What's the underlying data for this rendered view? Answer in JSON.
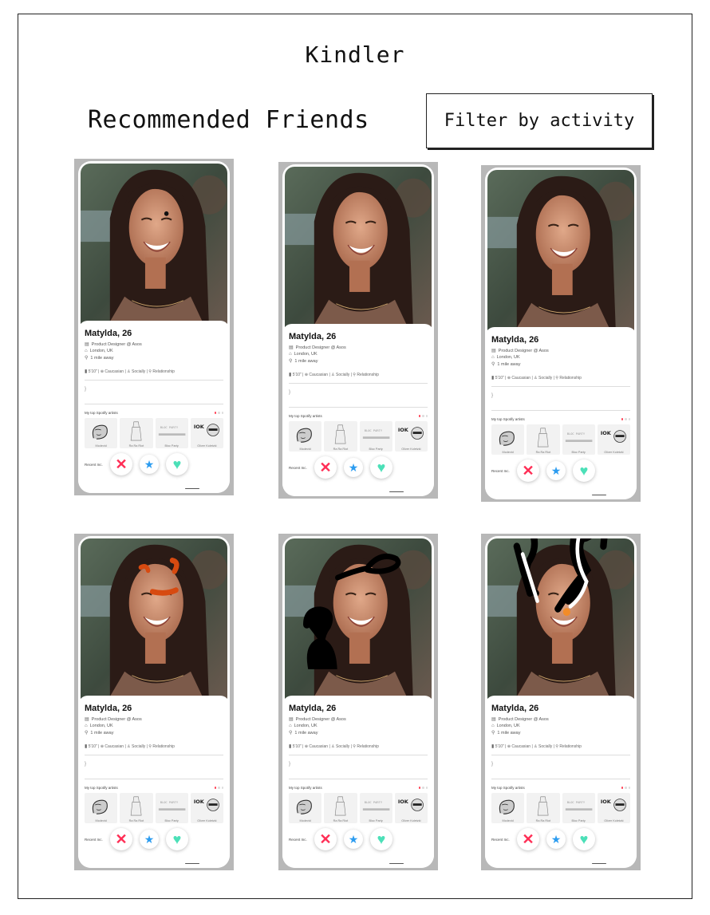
{
  "app": {
    "title": "Kindler"
  },
  "header": {
    "section_title": "Recommended Friends",
    "filter_label": "Filter by activity"
  },
  "colors": {
    "nope": "#ff2d55",
    "star": "#2c9cf0",
    "heart": "#4ce0b8",
    "active_dot": "#ff4458"
  },
  "icons": {
    "nope": "close-icon",
    "super_like": "star-icon",
    "like": "heart-icon"
  },
  "profile": {
    "name_age": "Matylda, 26",
    "job": "Product Designer @ Asos",
    "location": "London, UK",
    "distance": "1 mile away",
    "attributes": "5'10\" | ⊕ Caucasian | ♙ Socially | ⚲ Relationship",
    "bio": "}",
    "spotify_label": "My top Spotify artists",
    "artists": [
      "Mcdevid",
      "Ra Ra Riot",
      "Bloc Party",
      "Oliver Koletzki"
    ],
    "recent_label": "Recent Inc."
  },
  "cards": [
    {
      "id": "card-1"
    },
    {
      "id": "card-2"
    },
    {
      "id": "card-3"
    },
    {
      "id": "card-4"
    },
    {
      "id": "card-5"
    },
    {
      "id": "card-6"
    }
  ]
}
